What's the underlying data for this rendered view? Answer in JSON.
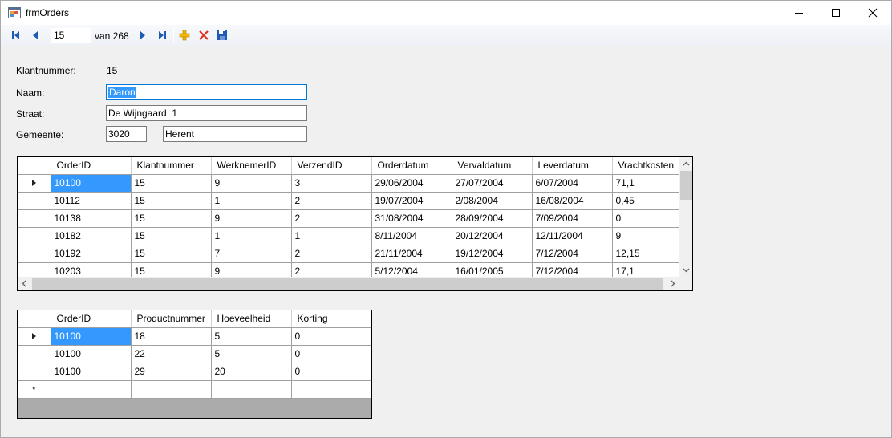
{
  "window": {
    "title": "frmOrders"
  },
  "navigator": {
    "position": "15",
    "count_label": "van 268"
  },
  "form": {
    "klantnummer_label": "Klantnummer:",
    "klantnummer_value": "15",
    "naam_label": "Naam:",
    "naam_value": "Daron",
    "straat_label": "Straat:",
    "straat_value": "De Wijngaard  1",
    "gemeente_label": "Gemeente:",
    "postcode_value": "3020",
    "gemeente_value": "Herent"
  },
  "orders_grid": {
    "columns": [
      "OrderID",
      "Klantnummer",
      "WerknemerID",
      "VerzendID",
      "Orderdatum",
      "Vervaldatum",
      "Leverdatum",
      "Vrachtkosten"
    ],
    "rows": [
      [
        "10100",
        "15",
        "9",
        "3",
        "29/06/2004",
        "27/07/2004",
        "6/07/2004",
        "71,1"
      ],
      [
        "10112",
        "15",
        "1",
        "2",
        "19/07/2004",
        "2/08/2004",
        "16/08/2004",
        "0,45"
      ],
      [
        "10138",
        "15",
        "9",
        "2",
        "31/08/2004",
        "28/09/2004",
        "7/09/2004",
        "0"
      ],
      [
        "10182",
        "15",
        "1",
        "1",
        "8/11/2004",
        "20/12/2004",
        "12/11/2004",
        "9"
      ],
      [
        "10192",
        "15",
        "7",
        "2",
        "21/11/2004",
        "19/12/2004",
        "7/12/2004",
        "12,15"
      ],
      [
        "10203",
        "15",
        "9",
        "2",
        "5/12/2004",
        "16/01/2005",
        "7/12/2004",
        "17,1"
      ]
    ]
  },
  "details_grid": {
    "columns": [
      "OrderID",
      "Productnummer",
      "Hoeveelheid",
      "Korting"
    ],
    "rows": [
      [
        "10100",
        "18",
        "5",
        "0"
      ],
      [
        "10100",
        "22",
        "5",
        "0"
      ],
      [
        "10100",
        "29",
        "20",
        "0"
      ]
    ],
    "new_row_marker": "*"
  },
  "colors": {
    "selection": "#3399ff",
    "accent": "#0078d7",
    "grid_background": "#ababab"
  }
}
